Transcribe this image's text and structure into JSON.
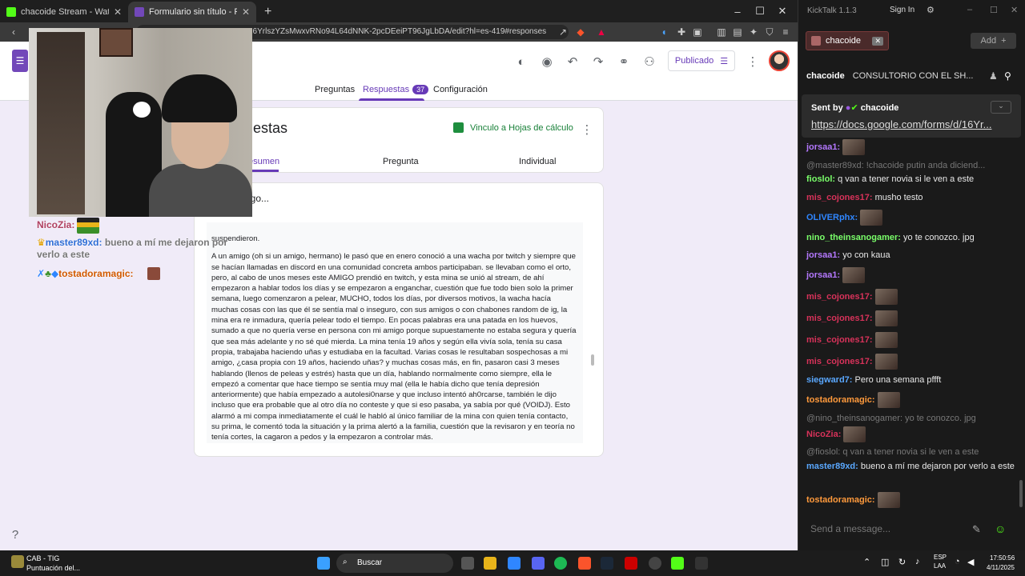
{
  "browser": {
    "tabs": [
      {
        "title": "chacoide Stream - Watch Live on",
        "favicon_color": "#53fc18"
      },
      {
        "title": "Formulario sin título - Formulari",
        "favicon_color": "#7248b9"
      }
    ],
    "new_tab": "+",
    "url": "16YrlszYZsMwxvRNo94L64dNNK-2pcDEeiPT96JgLbDA/edit?hl=es-419#responses",
    "window_controls": [
      "–",
      "☐",
      "✕"
    ]
  },
  "forms": {
    "published_label": "Publicado",
    "tabs": [
      {
        "label": "Preguntas"
      },
      {
        "label": "Respuestas",
        "count": "37"
      },
      {
        "label": "Configuración"
      }
    ],
    "responses_title": "puestas",
    "sheets_link": "Vinculo a Hojas de cálculo",
    "subtabs": [
      "esumen",
      "Pregunta",
      "Individual"
    ],
    "question_title": "migo...",
    "response_paragraphs": [
      "suspendieron.",
      "A un amigo (oh si un amigo, hermano) le pasó que en enero conoció a una wacha por twitch y siempre que se hacían llamadas en discord en una comunidad concreta ambos participaban. se llevaban como el orto, pero, al cabo de unos meses este AMIGO prendió en twitch, y esta mina se unió al stream, de ahí empezaron a hablar todos los días y se empezaron a enganchar, cuestión que fue todo bien solo la primer semana, luego comenzaron a pelear, MUCHO, todos los días, por diversos motivos, la wacha hacía muchas cosas con las que él se sentía mal o inseguro, con sus amigos o con chabones random de ig, la mina era re inmadura, quería pelear todo el tiempo. En pocas palabras era una patada en los huevos, sumado a que no quería verse en persona con mi amigo porque supuestamente no estaba segura y quería que sea más adelante y no sé qué mierda. La mina tenía 19 años y según ella vivía sola, tenía su casa propia, trabajaba haciendo uñas y estudiaba en la facultad. Varias cosas le resultaban sospechosas a mi amigo, ¿casa propia con 19 años, haciendo uñas? y muchas cosas más, en fin, pasaron casi 3 meses hablando (llenos de peleas y estrés) hasta que un día, hablando normalmente como siempre, ella le empezó a comentar que hace tiempo se sentía muy mal (ella le había dicho que tenía depresión anteriormente) que había empezado a autolesi0narse y que incluso intentó ah0rcarse, también le dijo incluso que era probable que al otro día no conteste y que si eso pasaba, ya sabía por qué (VOIDJ). Esto alarmó a mi compa inmediatamente el cuál le habló al único familiar de la mina con quien tenía contacto, su prima, le comentó toda la situación y la prima alertó a la familia, cuestión que la revisaron y en teoría no tenía cortes, la cagaron a pedos y la empezaron a controlar más."
    ]
  },
  "stream_overlay": [
    {
      "user": "NicoZia:",
      "text": ""
    },
    {
      "user": "master89xd:",
      "text": "bueno a mí me dejaron por verlo a este"
    },
    {
      "user": "tostadoramagic:",
      "text": ""
    }
  ],
  "kicktalk": {
    "title": "KickTalk 1.1.3",
    "sign_in": "Sign In",
    "tab": "chacoide",
    "add_label": "Add",
    "channel": "chacoide",
    "channel_title": "CONSULTORIO CON EL SH...",
    "pinned_by_label": "Sent by",
    "pinned_by_user": "chacoide",
    "pinned_link": "https://docs.google.com/forms/d/16Yr...",
    "messages": [
      {
        "user": "jorsaa1:",
        "color": "#b478ff",
        "text": "",
        "emote": true
      },
      {
        "reply": true,
        "text": "@master89xd: !chacoide putin anda diciend..."
      },
      {
        "user": "fioslol:",
        "color": "#7aff6a",
        "text": "q van a tener novia si le ven a este"
      },
      {
        "user": "mis_cojones17:",
        "color": "#d8325a",
        "text": "musho testo"
      },
      {
        "user": "OLIVERphx:",
        "color": "#2f86ff",
        "text": "",
        "emote": true
      },
      {
        "user": "nino_theinsanogamer:",
        "color": "#7aff6a",
        "text": "yo te conozco. jpg"
      },
      {
        "user": "jorsaa1:",
        "color": "#b478ff",
        "text": "yo con kaua"
      },
      {
        "user": "jorsaa1:",
        "color": "#b478ff",
        "text": "",
        "emote": true
      },
      {
        "user": "mis_cojones17:",
        "color": "#d8325a",
        "text": "",
        "emote": true
      },
      {
        "user": "mis_cojones17:",
        "color": "#d8325a",
        "text": "",
        "emote": true
      },
      {
        "user": "mis_cojones17:",
        "color": "#d8325a",
        "text": "",
        "emote": true
      },
      {
        "user": "mis_cojones17:",
        "color": "#d8325a",
        "text": "",
        "emote": true
      },
      {
        "user": "siegward7:",
        "color": "#5aa8ff",
        "text": "Pero una semana pffft"
      },
      {
        "user": "tostadoramagic:",
        "color": "#ff9a3c",
        "text": "",
        "emote": true
      },
      {
        "reply": true,
        "text": "@nino_theinsanogamer: yo te conozco. jpg"
      },
      {
        "user": "NicoZia:",
        "color": "#d8325a",
        "text": "",
        "emote": true
      },
      {
        "reply": true,
        "text": "@fioslol: q van a tener novia si le ven a este"
      },
      {
        "user": "master89xd:",
        "color": "#5aa8ff",
        "text": "bueno a mí me dejaron por verlo a este"
      },
      {
        "user": "tostadoramagic:",
        "color": "#ff9a3c",
        "text": "",
        "emote": true
      }
    ],
    "send_placeholder": "Send a message..."
  },
  "taskbar": {
    "app_name": "CAB - TIG",
    "app_sub": "Puntuación del...",
    "search_label": "Buscar",
    "lang1": "ESP",
    "lang2": "LAA",
    "time": "17:50:56",
    "date": "4/11/2025"
  }
}
